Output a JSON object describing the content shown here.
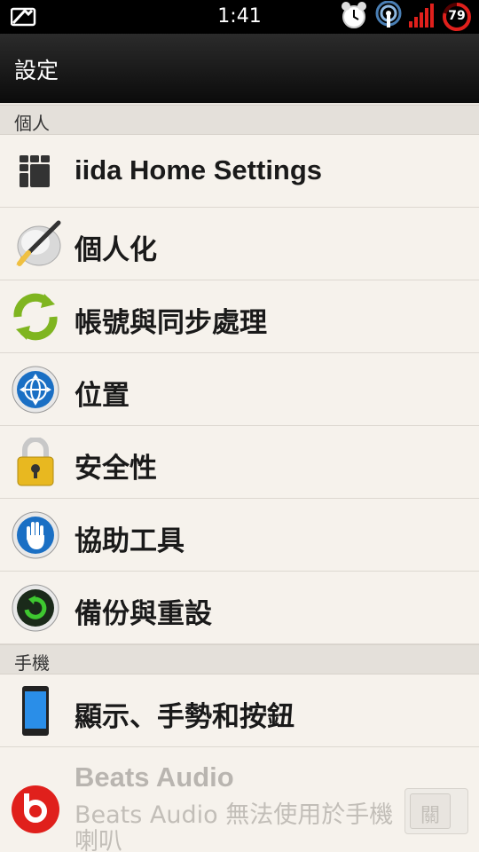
{
  "status_bar": {
    "time": "1:41",
    "battery_level": "79",
    "icons": [
      "message-icon",
      "alarm-icon",
      "wifi-hotspot-icon",
      "signal-icon",
      "battery-icon"
    ],
    "accent": "#e0201c"
  },
  "action_bar": {
    "title": "設定"
  },
  "sections": {
    "personal": {
      "header": "個人"
    },
    "phone": {
      "header": "手機"
    }
  },
  "items": [
    {
      "label": "iida Home Settings",
      "icon": "iida-home-icon"
    },
    {
      "label": "個人化",
      "icon": "paintbrush-icon"
    },
    {
      "label": "帳號與同步處理",
      "icon": "sync-icon"
    },
    {
      "label": "位置",
      "icon": "globe-icon"
    },
    {
      "label": "安全性",
      "icon": "lock-icon"
    },
    {
      "label": "協助工具",
      "icon": "hand-icon"
    },
    {
      "label": "備份與重設",
      "icon": "backup-icon"
    },
    {
      "label": "顯示、手勢和按鈕",
      "icon": "phone-display-icon"
    }
  ],
  "beats": {
    "title": "Beats Audio",
    "subtitle": "Beats Audio 無法使用於手機喇叭",
    "toggle_label": "關",
    "icon": "beats-audio-icon"
  }
}
